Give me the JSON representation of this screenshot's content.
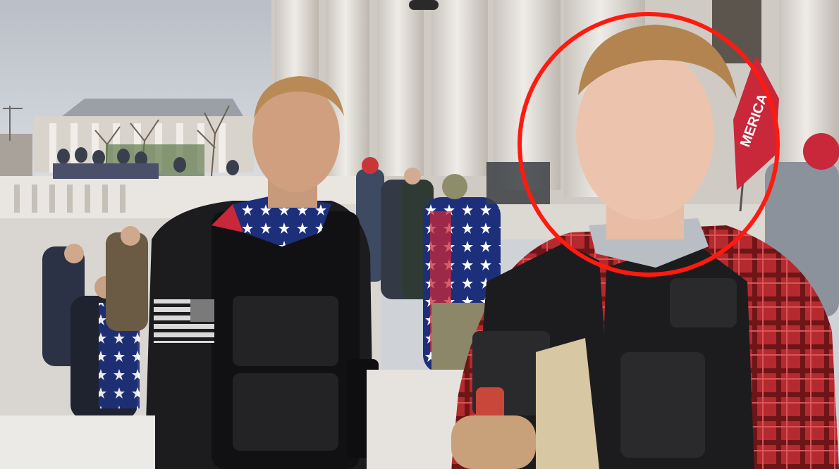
{
  "scene": {
    "flag_text": "MERICA",
    "colors": {
      "sky": "#cdd2d8",
      "marble": "#e4e1dc",
      "marble_shadow": "#bdb8b1",
      "annotation_circle": "#ff1a0f",
      "flag_red": "#c8283a",
      "vest_black": "#1c1c1e",
      "plaid_red": "#b52a2e"
    },
    "icons": {
      "flag_patch": "us-flag-patch-icon"
    }
  }
}
